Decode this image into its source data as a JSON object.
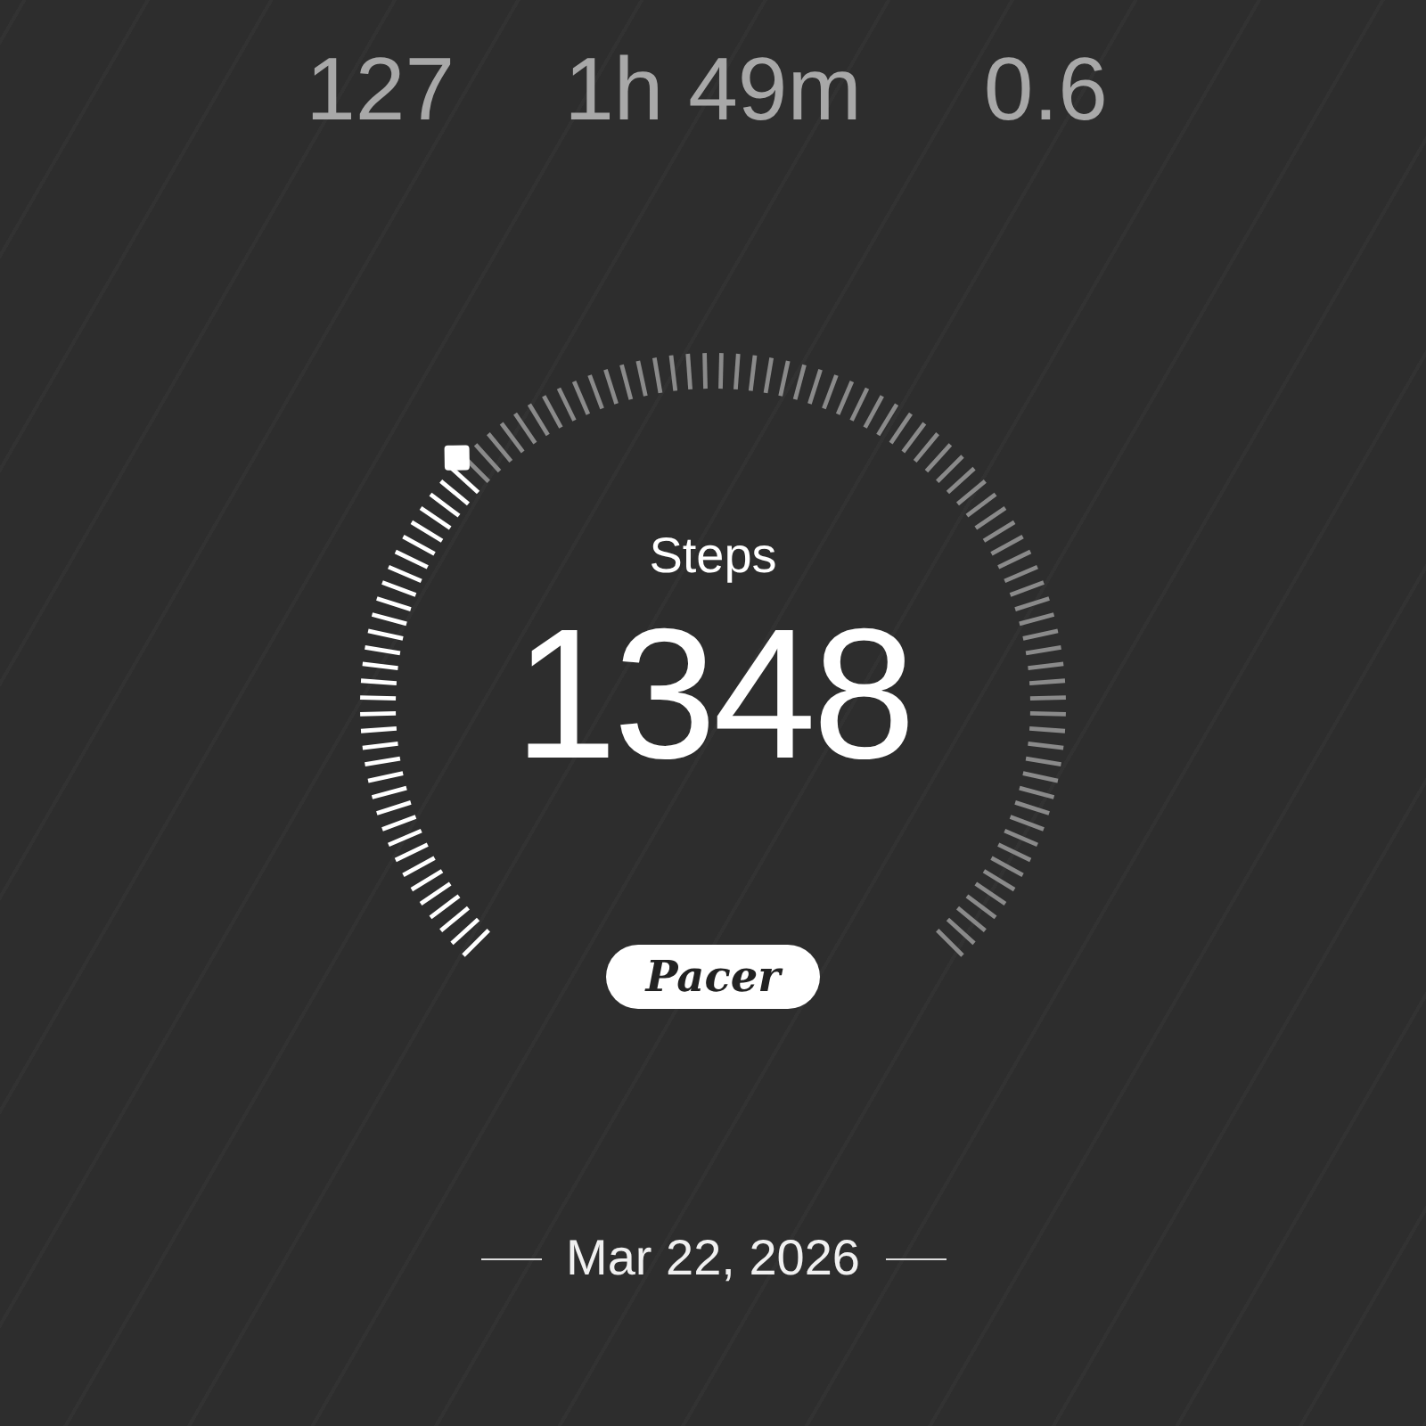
{
  "stats": [
    {
      "value": "127"
    },
    {
      "value": "1h 49m"
    },
    {
      "value": "0.6"
    }
  ],
  "gauge": {
    "label": "Steps",
    "value": "1348",
    "badge": "Pacer"
  },
  "date": "Mar 22, 2026"
}
